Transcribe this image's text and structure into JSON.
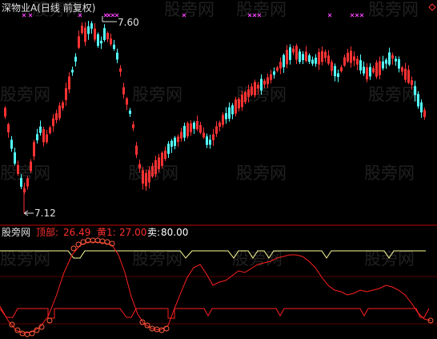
{
  "main_panel": {
    "title": "深物业A(日线 前复权)",
    "high_marker": "7.60",
    "low_marker": "7.12",
    "arrow_icon": "left-arrow-icon"
  },
  "indicator_panel": {
    "name": "股旁网",
    "items": [
      {
        "label": "顶部:",
        "value": "26.49",
        "color": "#ff3030"
      },
      {
        "label": "黄1:",
        "value": "27.00",
        "color": "#ff3030"
      },
      {
        "label": "卖:",
        "value": "80.00",
        "color": "#ffffff"
      }
    ]
  },
  "watermark_text": "股旁网",
  "colors": {
    "up": "#ff3232",
    "down": "#54ffff",
    "yellow": "#ffff99",
    "red_line": "#ff2020",
    "divider": "#c00000",
    "marker": "#ff44ff"
  },
  "chart_data": {
    "type": "candlestick",
    "price_range": [
      7.12,
      7.6
    ],
    "oscillator_ylim": [
      0,
      100
    ],
    "oscillator_levels": {
      "top": 26.49,
      "yellow1": 27.0,
      "sell": 80.0
    }
  }
}
